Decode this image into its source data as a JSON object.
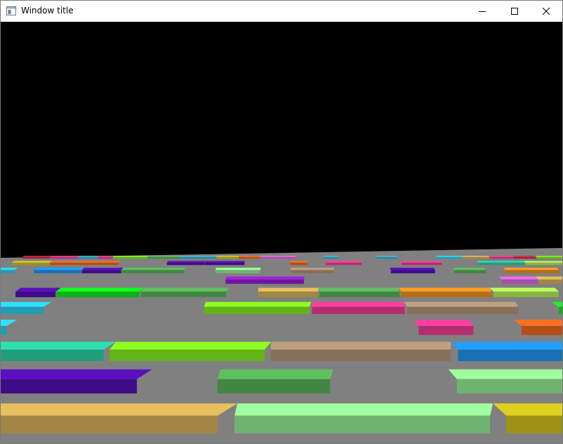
{
  "window": {
    "title": "Window title",
    "controls": {
      "minimize_icon": "minimize-icon",
      "maximize_icon": "maximize-icon",
      "close_icon": "close-icon"
    }
  },
  "scene": {
    "sky_color": "#000000",
    "floor_color": "#808080"
  }
}
